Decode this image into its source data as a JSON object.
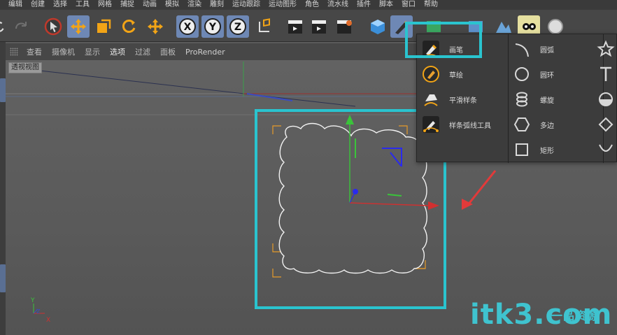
{
  "menu": [
    "编辑",
    "创建",
    "选择",
    "工具",
    "网格",
    "捕捉",
    "动画",
    "模拟",
    "渲染",
    "雕刻",
    "运动跟踪",
    "运动图形",
    "角色",
    "流水线",
    "插件",
    "脚本",
    "窗口",
    "帮助"
  ],
  "viewport_menu": {
    "items": [
      "查看",
      "摄像机",
      "显示",
      "选项",
      "过滤",
      "面板"
    ],
    "prorender": "ProRender"
  },
  "viewport": {
    "label": "透视视图"
  },
  "flyout": {
    "col1": [
      {
        "label": "画笔",
        "icon": "pen-icon"
      },
      {
        "label": "草绘",
        "icon": "sketch-icon"
      },
      {
        "label": "平滑样条",
        "icon": "smooth-spline-icon"
      },
      {
        "label": "样条弧线工具",
        "icon": "spline-arc-tool-icon"
      }
    ],
    "col2": [
      {
        "label": "圆弧",
        "icon": "arc-icon"
      },
      {
        "label": "圆环",
        "icon": "circle-icon"
      },
      {
        "label": "螺旋",
        "icon": "helix-icon"
      },
      {
        "label": "多边",
        "icon": "polygon-icon"
      },
      {
        "label": "矩形",
        "icon": "rectangle-icon"
      }
    ]
  },
  "axis": {
    "x": "X",
    "y": "Y",
    "z": "Z"
  },
  "watermark": {
    "text": "itk3",
    "domain": ".com",
    "cn": "一品资源"
  },
  "colors": {
    "highlight": "#2ac4cf",
    "arrow": "#e23a3a",
    "accent_tool": "#6e88b5"
  }
}
